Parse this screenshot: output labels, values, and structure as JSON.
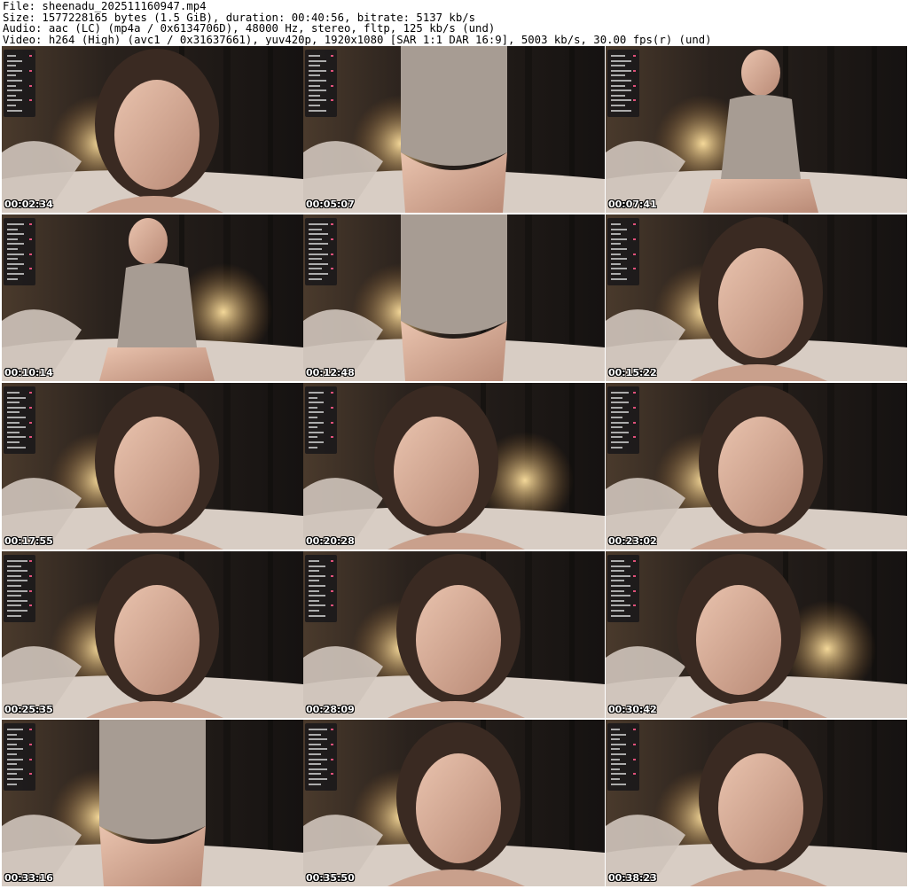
{
  "header": {
    "file_line": "File: sheenadu_202511160947.mp4",
    "size_line": "Size: 1577228165 bytes (1.5 GiB), duration: 00:40:56, bitrate: 5137 kb/s",
    "audio_line": "Audio: aac (LC) (mp4a / 0x6134706D), 48000 Hz, stereo, fltp, 125 kb/s (und)",
    "video_line": "Video: h264 (High) (avc1 / 0x31637661), yuv420p, 1920x1080 [SAR 1:1 DAR 16:9], 5003 kb/s, 30.00 fps(r) (und)"
  },
  "thumbnails": [
    {
      "timestamp": "00:02:34"
    },
    {
      "timestamp": "00:05:07"
    },
    {
      "timestamp": "00:07:41"
    },
    {
      "timestamp": "00:10:14"
    },
    {
      "timestamp": "00:12:48"
    },
    {
      "timestamp": "00:15:22"
    },
    {
      "timestamp": "00:17:55"
    },
    {
      "timestamp": "00:20:28"
    },
    {
      "timestamp": "00:23:02"
    },
    {
      "timestamp": "00:25:35"
    },
    {
      "timestamp": "00:28:09"
    },
    {
      "timestamp": "00:30:42"
    },
    {
      "timestamp": "00:33:16"
    },
    {
      "timestamp": "00:35:50"
    },
    {
      "timestamp": "00:38:23"
    }
  ]
}
